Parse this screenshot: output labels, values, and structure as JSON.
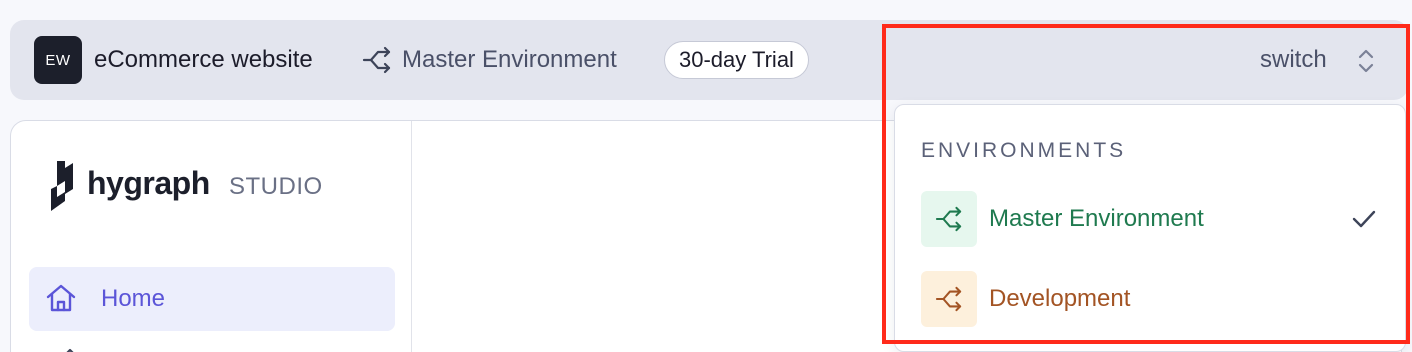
{
  "header": {
    "project_initials": "EW",
    "project_name": "eCommerce website",
    "current_environment": "Master Environment",
    "trial_badge": "30-day Trial",
    "switch_label": "switch"
  },
  "sidebar": {
    "logo_text": "hygraph",
    "logo_suffix": "STUDIO",
    "items": [
      {
        "label": "Home",
        "icon": "home-icon",
        "active": true
      }
    ]
  },
  "environment_dropdown": {
    "heading": "ENVIRONMENTS",
    "items": [
      {
        "label": "Master Environment",
        "icon": "branch-icon",
        "color": "#1f7a4f",
        "selected": true
      },
      {
        "label": "Development",
        "icon": "branch-icon",
        "color": "#a35424",
        "selected": false
      }
    ]
  },
  "colors": {
    "highlight": "#ff2a1a",
    "accent": "#5b55d8"
  }
}
